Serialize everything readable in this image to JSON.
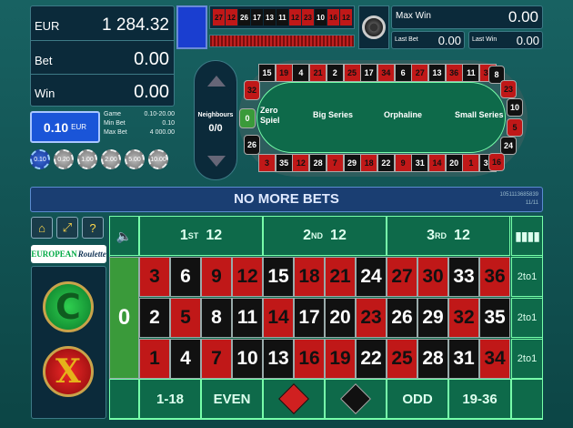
{
  "balance": {
    "currency": "EUR",
    "amount": "1 284.32"
  },
  "bet": {
    "label": "Bet",
    "value": "0.00"
  },
  "win": {
    "label": "Win",
    "value": "0.00"
  },
  "coin": {
    "value": "0.10",
    "currency": "EUR"
  },
  "limits": {
    "game_label": "Game",
    "game_value": "0.10-20.00",
    "min_label": "Min Bet",
    "min_value": "0.10",
    "max_label": "Max Bet",
    "max_value": "4 000.00"
  },
  "chips": [
    "0.10",
    "0.20",
    "1.00",
    "2.00",
    "5.00",
    "10.00"
  ],
  "history": [
    {
      "n": "27",
      "c": "red"
    },
    {
      "n": "12",
      "c": "red"
    },
    {
      "n": "26",
      "c": "black"
    },
    {
      "n": "17",
      "c": "black"
    },
    {
      "n": "13",
      "c": "black"
    },
    {
      "n": "11",
      "c": "black"
    },
    {
      "n": "12",
      "c": "red"
    },
    {
      "n": "23",
      "c": "red"
    },
    {
      "n": "10",
      "c": "black"
    },
    {
      "n": "16",
      "c": "red"
    },
    {
      "n": "12",
      "c": "red"
    }
  ],
  "max_win": {
    "label": "Max Win",
    "value": "0.00"
  },
  "last_bet": {
    "label": "Last Bet",
    "value": "0.00"
  },
  "last_win": {
    "label": "Last Win",
    "value": "0.00"
  },
  "racetrack": {
    "neighbours_label": "Neighbours",
    "neighbours_value": "0/0",
    "sections": [
      "Zero Spiel",
      "Big Series",
      "Orphaline",
      "Small Series"
    ],
    "top_numbers": [
      {
        "n": "15",
        "c": "black"
      },
      {
        "n": "19",
        "c": "red"
      },
      {
        "n": "4",
        "c": "black"
      },
      {
        "n": "21",
        "c": "red"
      },
      {
        "n": "2",
        "c": "black"
      },
      {
        "n": "25",
        "c": "red"
      },
      {
        "n": "17",
        "c": "black"
      },
      {
        "n": "34",
        "c": "red"
      },
      {
        "n": "6",
        "c": "black"
      },
      {
        "n": "27",
        "c": "red"
      },
      {
        "n": "13",
        "c": "black"
      },
      {
        "n": "36",
        "c": "red"
      },
      {
        "n": "11",
        "c": "black"
      },
      {
        "n": "30",
        "c": "red"
      }
    ],
    "bottom_numbers": [
      {
        "n": "3",
        "c": "red"
      },
      {
        "n": "35",
        "c": "black"
      },
      {
        "n": "12",
        "c": "red"
      },
      {
        "n": "28",
        "c": "black"
      },
      {
        "n": "7",
        "c": "red"
      },
      {
        "n": "29",
        "c": "black"
      },
      {
        "n": "18",
        "c": "red"
      },
      {
        "n": "22",
        "c": "black"
      },
      {
        "n": "9",
        "c": "red"
      },
      {
        "n": "31",
        "c": "black"
      },
      {
        "n": "14",
        "c": "red"
      },
      {
        "n": "20",
        "c": "black"
      },
      {
        "n": "1",
        "c": "red"
      },
      {
        "n": "33",
        "c": "black"
      }
    ],
    "left_numbers": [
      {
        "n": "32",
        "c": "red"
      },
      {
        "n": "0",
        "c": "green"
      },
      {
        "n": "26",
        "c": "black"
      }
    ],
    "right_numbers": [
      {
        "n": "8",
        "c": "black"
      },
      {
        "n": "23",
        "c": "red"
      },
      {
        "n": "10",
        "c": "black"
      },
      {
        "n": "5",
        "c": "red"
      },
      {
        "n": "24",
        "c": "black"
      },
      {
        "n": "16",
        "c": "red"
      }
    ]
  },
  "status": {
    "message": "NO MORE BETS",
    "round_id": "1051113685839",
    "round_sub": "11/11"
  },
  "logo": {
    "text1": "EUROPEAN",
    "text2": "Roulette"
  },
  "dozens": [
    {
      "ord": "1",
      "sup": "ST",
      "num": "12"
    },
    {
      "ord": "2",
      "sup": "ND",
      "num": "12"
    },
    {
      "ord": "3",
      "sup": "RD",
      "num": "12"
    }
  ],
  "grid": {
    "zero": "0",
    "rows": [
      [
        {
          "n": "3",
          "c": "red"
        },
        {
          "n": "6",
          "c": "black"
        },
        {
          "n": "9",
          "c": "red"
        },
        {
          "n": "12",
          "c": "red"
        },
        {
          "n": "15",
          "c": "black"
        },
        {
          "n": "18",
          "c": "red"
        },
        {
          "n": "21",
          "c": "red"
        },
        {
          "n": "24",
          "c": "black"
        },
        {
          "n": "27",
          "c": "red"
        },
        {
          "n": "30",
          "c": "red"
        },
        {
          "n": "33",
          "c": "black"
        },
        {
          "n": "36",
          "c": "red"
        }
      ],
      [
        {
          "n": "2",
          "c": "black"
        },
        {
          "n": "5",
          "c": "red"
        },
        {
          "n": "8",
          "c": "black"
        },
        {
          "n": "11",
          "c": "black"
        },
        {
          "n": "14",
          "c": "red"
        },
        {
          "n": "17",
          "c": "black"
        },
        {
          "n": "20",
          "c": "black"
        },
        {
          "n": "23",
          "c": "red"
        },
        {
          "n": "26",
          "c": "black"
        },
        {
          "n": "29",
          "c": "black"
        },
        {
          "n": "32",
          "c": "red"
        },
        {
          "n": "35",
          "c": "black"
        }
      ],
      [
        {
          "n": "1",
          "c": "red"
        },
        {
          "n": "4",
          "c": "black"
        },
        {
          "n": "7",
          "c": "red"
        },
        {
          "n": "10",
          "c": "black"
        },
        {
          "n": "13",
          "c": "black"
        },
        {
          "n": "16",
          "c": "red"
        },
        {
          "n": "19",
          "c": "red"
        },
        {
          "n": "22",
          "c": "black"
        },
        {
          "n": "25",
          "c": "red"
        },
        {
          "n": "28",
          "c": "black"
        },
        {
          "n": "31",
          "c": "black"
        },
        {
          "n": "34",
          "c": "red"
        }
      ]
    ],
    "column_label": "2to1"
  },
  "outside": {
    "low": "1-18",
    "even": "EVEN",
    "odd": "ODD",
    "high": "19-36"
  },
  "icons": {
    "home": "home-icon",
    "fullscreen": "fullscreen-icon",
    "help": "help-icon",
    "sound": "sound-icon",
    "stats": "stats-icon",
    "repeat": "repeat-icon",
    "clear": "clear-icon"
  },
  "colors": {
    "red": "#c01818",
    "black": "#111111",
    "green": "#3a9a3a",
    "felt": "#0e6a4a"
  }
}
